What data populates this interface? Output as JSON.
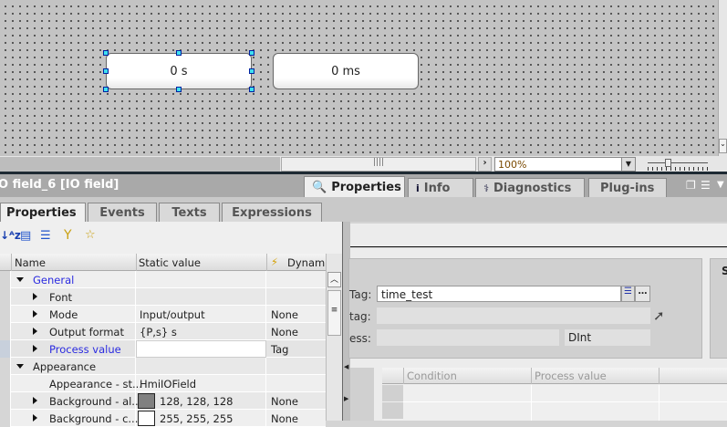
{
  "canvas": {
    "io_field_1": "0 s",
    "io_field_2": "0 ms"
  },
  "zoom": {
    "value": "100%"
  },
  "inspector": {
    "title": "O field_6 [IO field]",
    "tabs": [
      {
        "label": "Properties",
        "icon": "properties-icon"
      },
      {
        "label": "Info",
        "icon": "info-icon"
      },
      {
        "label": "Diagnostics",
        "icon": "diagnostics-icon"
      },
      {
        "label": "Plug-ins"
      }
    ],
    "subtabs": [
      "Properties",
      "Events",
      "Texts",
      "Expressions"
    ]
  },
  "table": {
    "headers": [
      "Name",
      "Static value",
      "Dynami"
    ],
    "rows": [
      {
        "name": "General",
        "value": "",
        "dynamic": "",
        "level": 0,
        "expanded": true,
        "link": true
      },
      {
        "name": "Font",
        "value": "",
        "dynamic": "",
        "level": 1
      },
      {
        "name": "Mode",
        "value": "Input/output",
        "dynamic": "None",
        "level": 1
      },
      {
        "name": "Output format",
        "value": "{P,s} s",
        "dynamic": "None",
        "level": 1
      },
      {
        "name": "Process value",
        "value": "",
        "dynamic": "Tag",
        "level": 1,
        "link": true
      },
      {
        "name": "Appearance",
        "value": "",
        "dynamic": "",
        "level": 0,
        "expanded": true
      },
      {
        "name": "Appearance - st...",
        "value": "HmiIOField",
        "dynamic": "",
        "level": 1,
        "noarrow": true
      },
      {
        "name": "Background - al...",
        "value": "128, 128, 128",
        "dynamic": "None",
        "level": 1,
        "swatch": "#808080"
      },
      {
        "name": "Background - c...",
        "value": "255, 255, 255",
        "dynamic": "None",
        "level": 1,
        "swatch": "#ffffff"
      }
    ]
  },
  "process": {
    "tag_label": "Tag:",
    "tag_value": "time_test",
    "plc_tag_label": "tag:",
    "address_label": "ess:",
    "data_type": "DInt",
    "right_box_label": "S"
  },
  "grid": {
    "headers": [
      "Condition",
      "Process value"
    ]
  }
}
